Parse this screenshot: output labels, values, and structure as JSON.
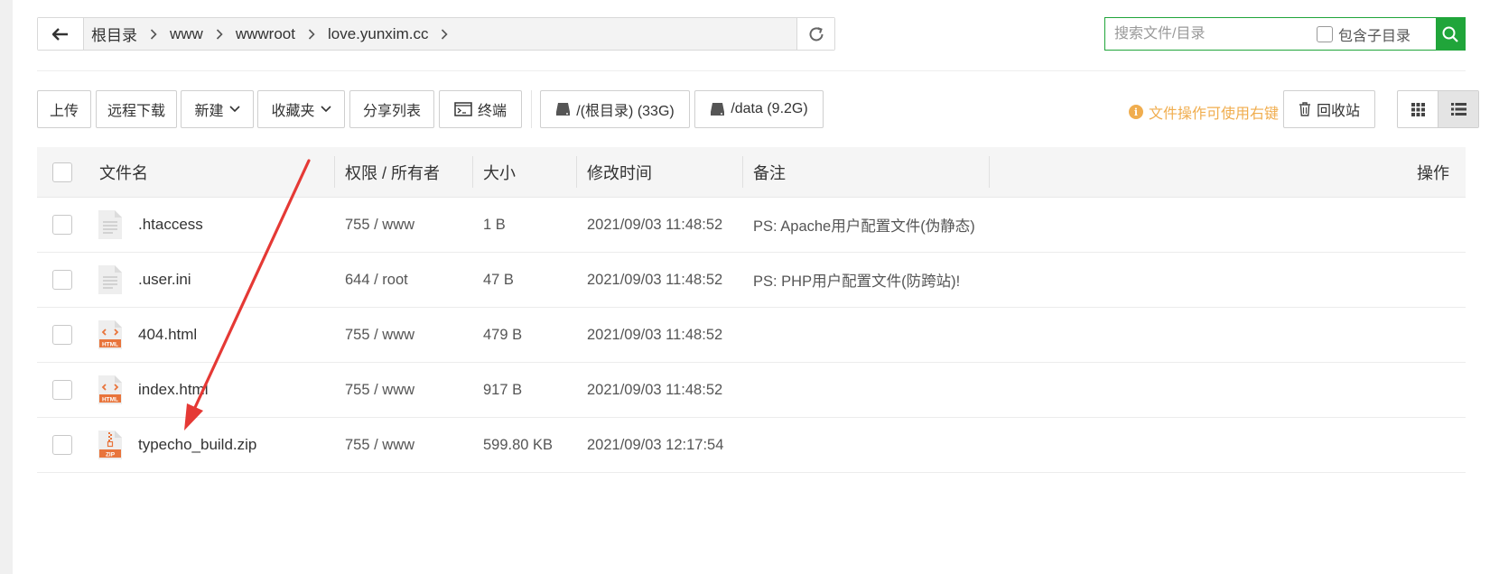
{
  "path": {
    "crumbs": [
      "根目录",
      "www",
      "wwwroot",
      "love.yunxim.cc"
    ]
  },
  "search": {
    "placeholder": "搜索文件/目录",
    "include_subdir_label": "包含子目录"
  },
  "toolbar": {
    "upload": "上传",
    "remote_download": "远程下载",
    "new": "新建",
    "favorites": "收藏夹",
    "share_list": "分享列表",
    "terminal": "终端",
    "disk_root": "/(根目录) (33G)",
    "disk_data": "/data (9.2G)",
    "hint": "文件操作可使用右键",
    "recycle_bin": "回收站"
  },
  "table": {
    "headers": {
      "name": "文件名",
      "perm": "权限 / 所有者",
      "size": "大小",
      "mtime": "修改时间",
      "note": "备注",
      "ops": "操作"
    },
    "rows": [
      {
        "name": ".htaccess",
        "icon": "text-file-icon",
        "perm": "755 / www",
        "size": "1 B",
        "mtime": "2021/09/03 11:48:52",
        "note": "PS: Apache用户配置文件(伪静态)"
      },
      {
        "name": ".user.ini",
        "icon": "text-file-icon",
        "perm": "644 / root",
        "size": "47 B",
        "mtime": "2021/09/03 11:48:52",
        "note": "PS: PHP用户配置文件(防跨站)!"
      },
      {
        "name": "404.html",
        "icon": "html-file-icon",
        "perm": "755 / www",
        "size": "479 B",
        "mtime": "2021/09/03 11:48:52",
        "note": ""
      },
      {
        "name": "index.html",
        "icon": "html-file-icon",
        "perm": "755 / www",
        "size": "917 B",
        "mtime": "2021/09/03 11:48:52",
        "note": ""
      },
      {
        "name": "typecho_build.zip",
        "icon": "zip-file-icon",
        "perm": "755 / www",
        "size": "599.80 KB",
        "mtime": "2021/09/03 12:17:54",
        "note": ""
      }
    ]
  },
  "colors": {
    "accent_green": "#20a53a",
    "hint_orange": "#f0ad4e",
    "html_icon": "#e8743b",
    "annotation_arrow": "#e53935"
  }
}
